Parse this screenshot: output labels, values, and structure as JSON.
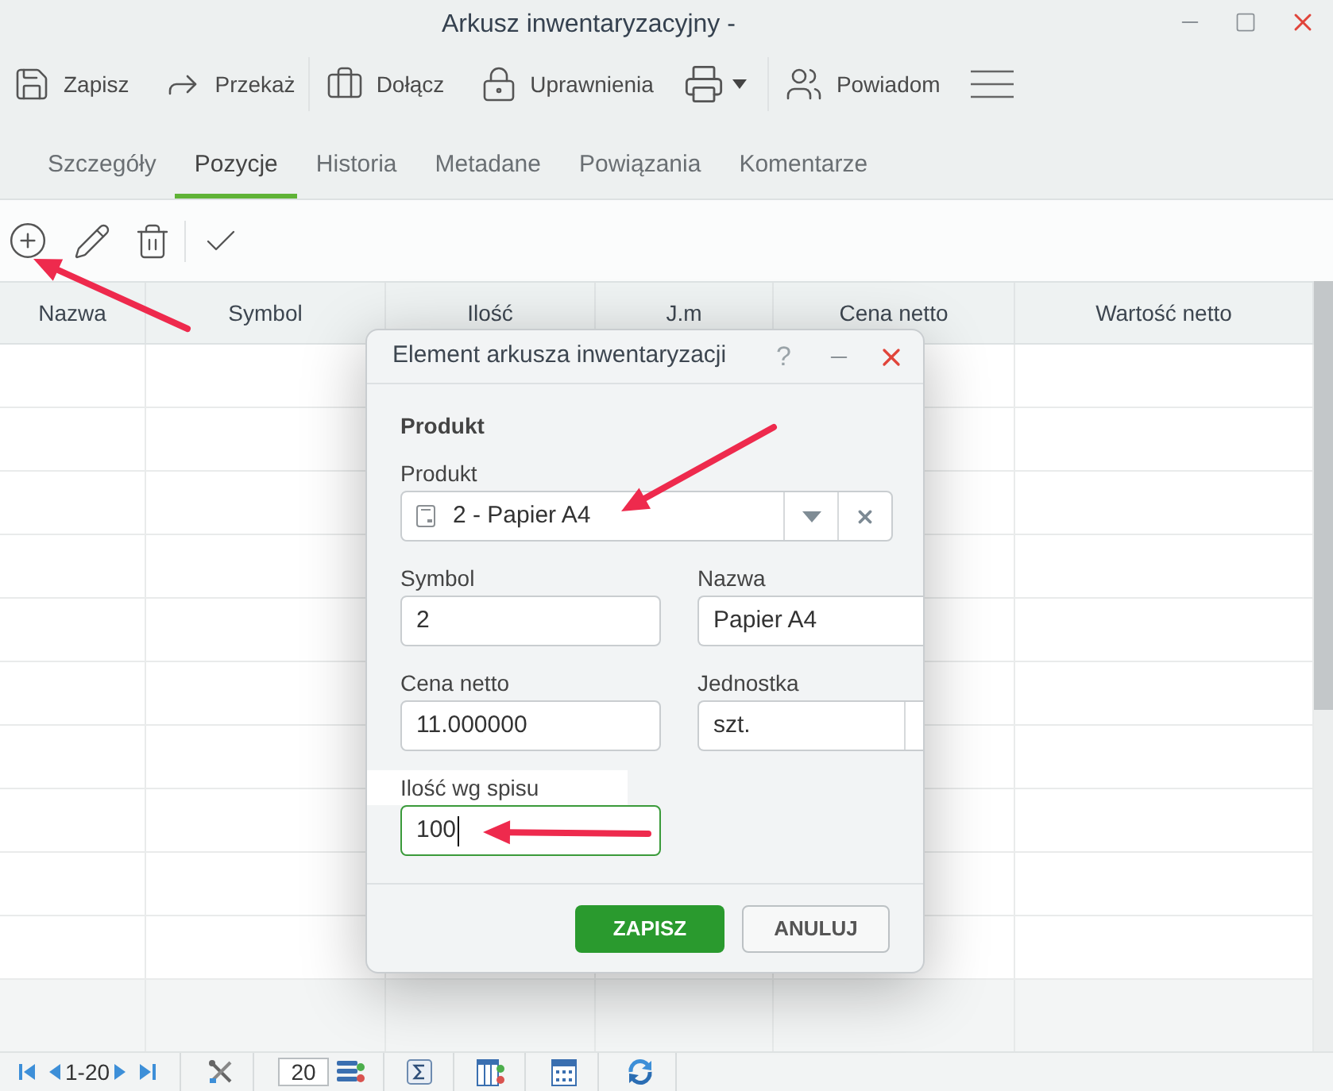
{
  "window": {
    "title": "Arkusz inwentaryzacyjny -"
  },
  "toolbar": [
    {
      "label": "Zapisz"
    },
    {
      "label": "Przekaż"
    },
    {
      "label": "Dołącz"
    },
    {
      "label": "Uprawnienia"
    },
    {
      "label": "Powiadom"
    }
  ],
  "tabs": [
    {
      "label": "Szczegóły",
      "selected": false
    },
    {
      "label": "Pozycje",
      "selected": true
    },
    {
      "label": "Historia",
      "selected": false
    },
    {
      "label": "Metadane",
      "selected": false
    },
    {
      "label": "Powiązania",
      "selected": false
    },
    {
      "label": "Komentarze",
      "selected": false
    }
  ],
  "table": {
    "columns": [
      "Nazwa",
      "Symbol",
      "Ilość",
      "J.m",
      "Cena netto",
      "Wartość netto"
    ]
  },
  "dialog": {
    "title": "Element arkusza inwentaryzacji",
    "help": "?",
    "section": "Produkt",
    "fields": [
      {
        "kind": "lookup",
        "label": "Produkt",
        "value": "2 - Papier A4",
        "focused": false
      },
      {
        "kind": "text",
        "label": "Symbol",
        "value": "2",
        "focused": false
      },
      {
        "kind": "text",
        "label": "Nazwa",
        "value": "Papier A4",
        "focused": false
      },
      {
        "kind": "text",
        "label": "Cena netto",
        "value": "11.000000",
        "focused": false
      },
      {
        "kind": "select",
        "label": "Jednostka",
        "value": "szt.",
        "focused": false
      },
      {
        "kind": "text",
        "label": "Ilość wg spisu",
        "value": "100",
        "focused": true
      }
    ],
    "buttons": [
      {
        "label": "ZAPISZ",
        "primary": true
      },
      {
        "label": "ANULUJ",
        "primary": false
      }
    ]
  },
  "pager": {
    "range": "1-20",
    "page_size": "20"
  }
}
